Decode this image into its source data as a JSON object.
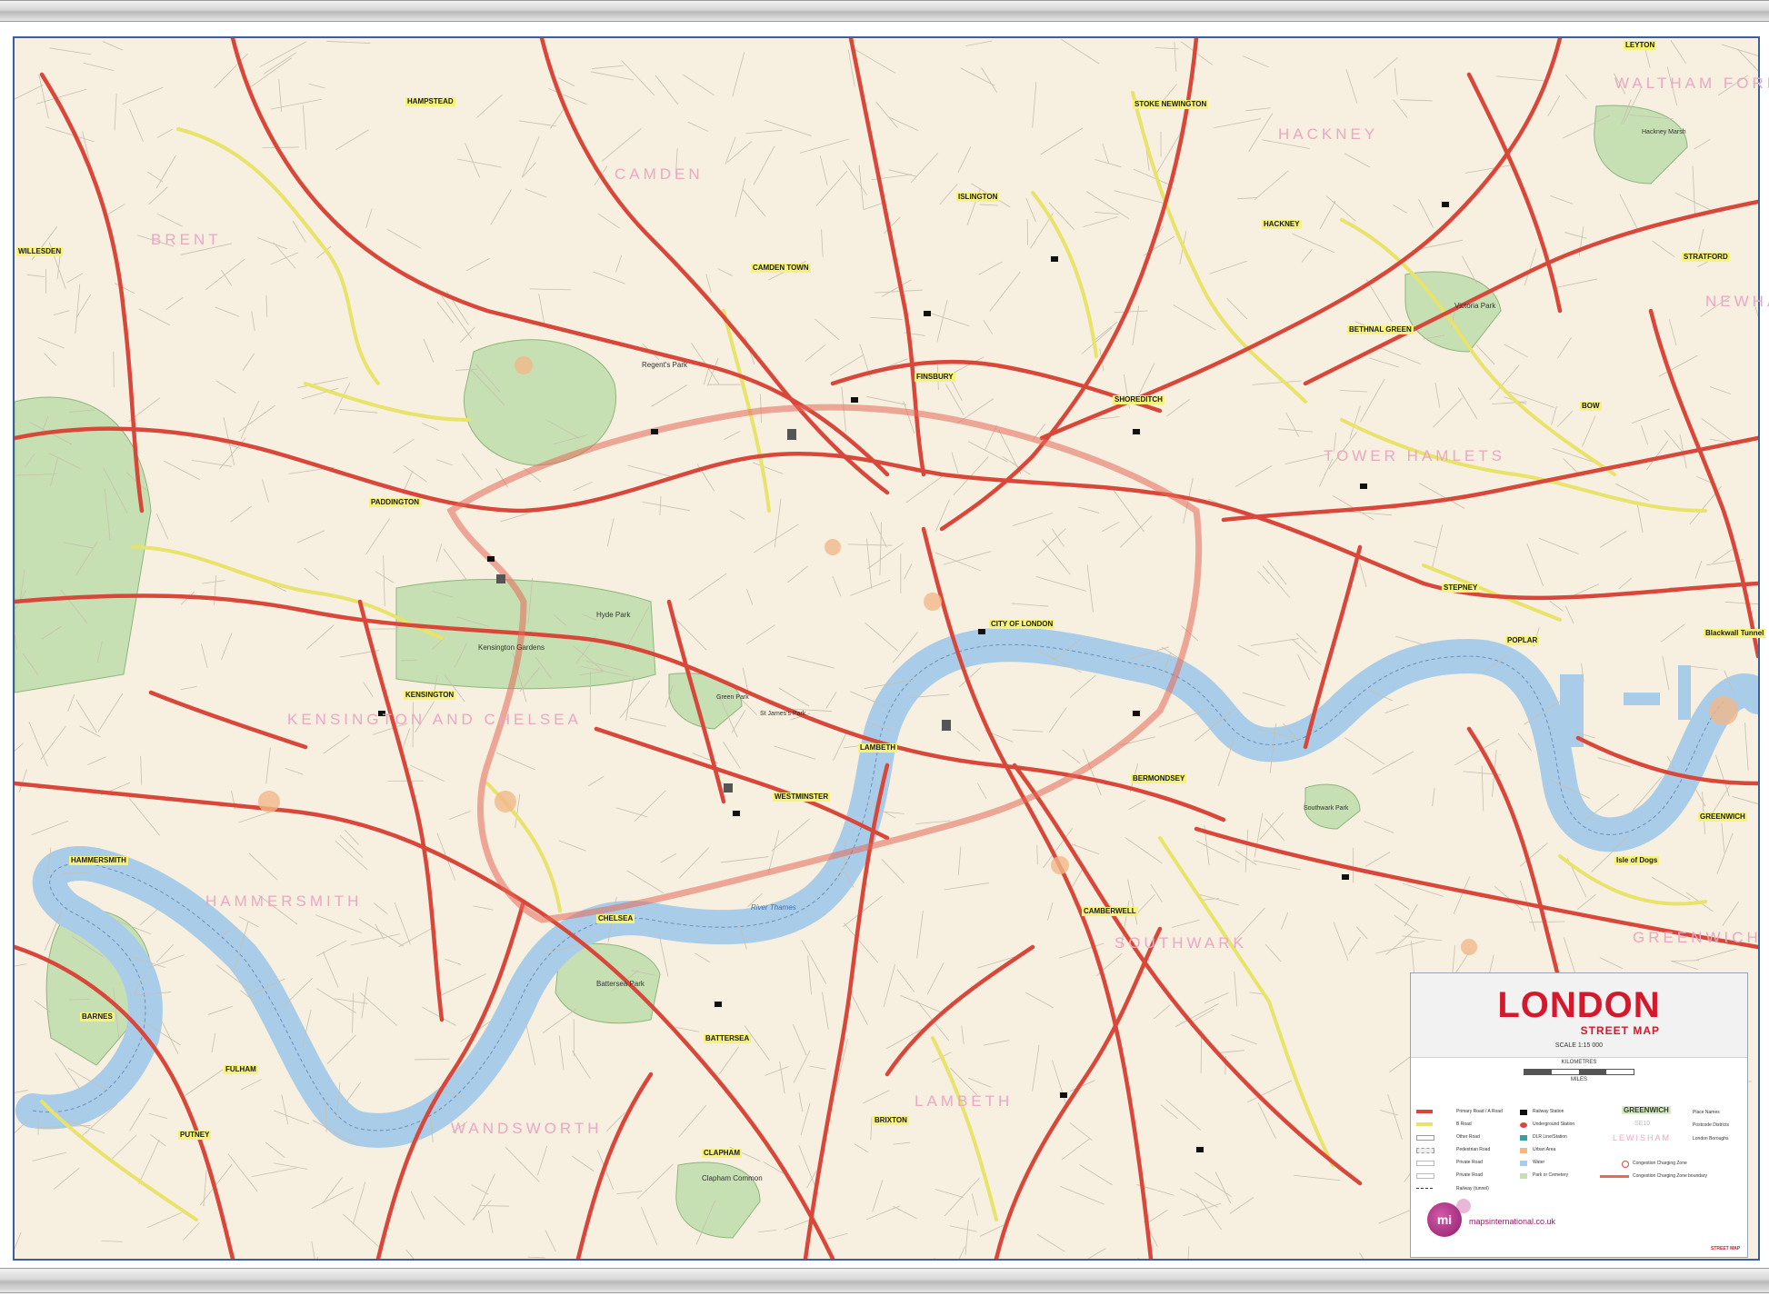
{
  "map": {
    "colors": {
      "primary_road": "#d9463a",
      "b_road": "#e8e36a",
      "river": "#a9cde8",
      "park": "#c6e0b4",
      "land": "#f7efdf",
      "borough_label": "#e9a8c3"
    },
    "place_labels": [
      "HAMPSTEAD",
      "CAMDEN TOWN",
      "STOKE NEWINGTON",
      "HACKNEY",
      "ISLINGTON",
      "WILLESDEN",
      "PADDINGTON",
      "FINSBURY",
      "SHOREDITCH",
      "BETHNAL GREEN",
      "BOW",
      "STRATFORD",
      "LEYTON",
      "KENSINGTON",
      "CITY OF LONDON",
      "STEPNEY",
      "POPLAR",
      "Blackwall Tunnel",
      "WESTMINSTER",
      "LAMBETH",
      "BERMONDSEY",
      "HAMMERSMITH",
      "CHELSEA",
      "CAMBERWELL",
      "BATTERSEA",
      "GREENWICH",
      "Isle of Dogs",
      "BARNES",
      "FULHAM",
      "PUTNEY",
      "BRIXTON",
      "CLAPHAM"
    ],
    "borough_labels": [
      "BRENT",
      "CAMDEN",
      "HACKNEY",
      "WALTHAM FOREST",
      "NEWHAM",
      "TOWER HAMLETS",
      "KENSINGTON AND CHELSEA",
      "HAMMERSMITH",
      "SOUTHWARK",
      "WANDSWORTH",
      "LAMBETH",
      "GREENWICH"
    ],
    "park_labels": [
      "Regent's Park",
      "Hyde Park",
      "Kensington Gardens",
      "Green Park",
      "St James's Park",
      "Battersea Park",
      "Clapham Common",
      "Victoria Park",
      "Hackney Marsh",
      "Southwark Park"
    ],
    "river_label": "River Thames"
  },
  "legend": {
    "title": "LONDON",
    "subtitle": "STREET MAP",
    "scale": "SCALE 1:15 000",
    "kilometres": "KILOMETRES",
    "miles": "MILES",
    "rows_left": [
      "Primary Road / A Road",
      "B Road",
      "Other Road",
      "Pedestrian Road",
      "Private Road",
      "Private Road",
      "Railway (tunnel)"
    ],
    "rows_mid": [
      "Railway Station",
      "Underground Station",
      "DLR Line/Station",
      "Urban Area",
      "Water",
      "Park or Cemetery"
    ],
    "place_name_sample": "GREENWICH",
    "place_name_text": "Place Names",
    "postcode_sample": "SE10",
    "postcode_text": "Postcode Districts",
    "borough_sample": "LEWISHAM",
    "borough_text": "London Boroughs",
    "ccz": "Congestion Charging Zone",
    "ccz_boundary": "Congestion Charging Zone boundary",
    "logo": "mi",
    "website": "mapsinternational.co.uk",
    "footer": "STREET MAP"
  }
}
